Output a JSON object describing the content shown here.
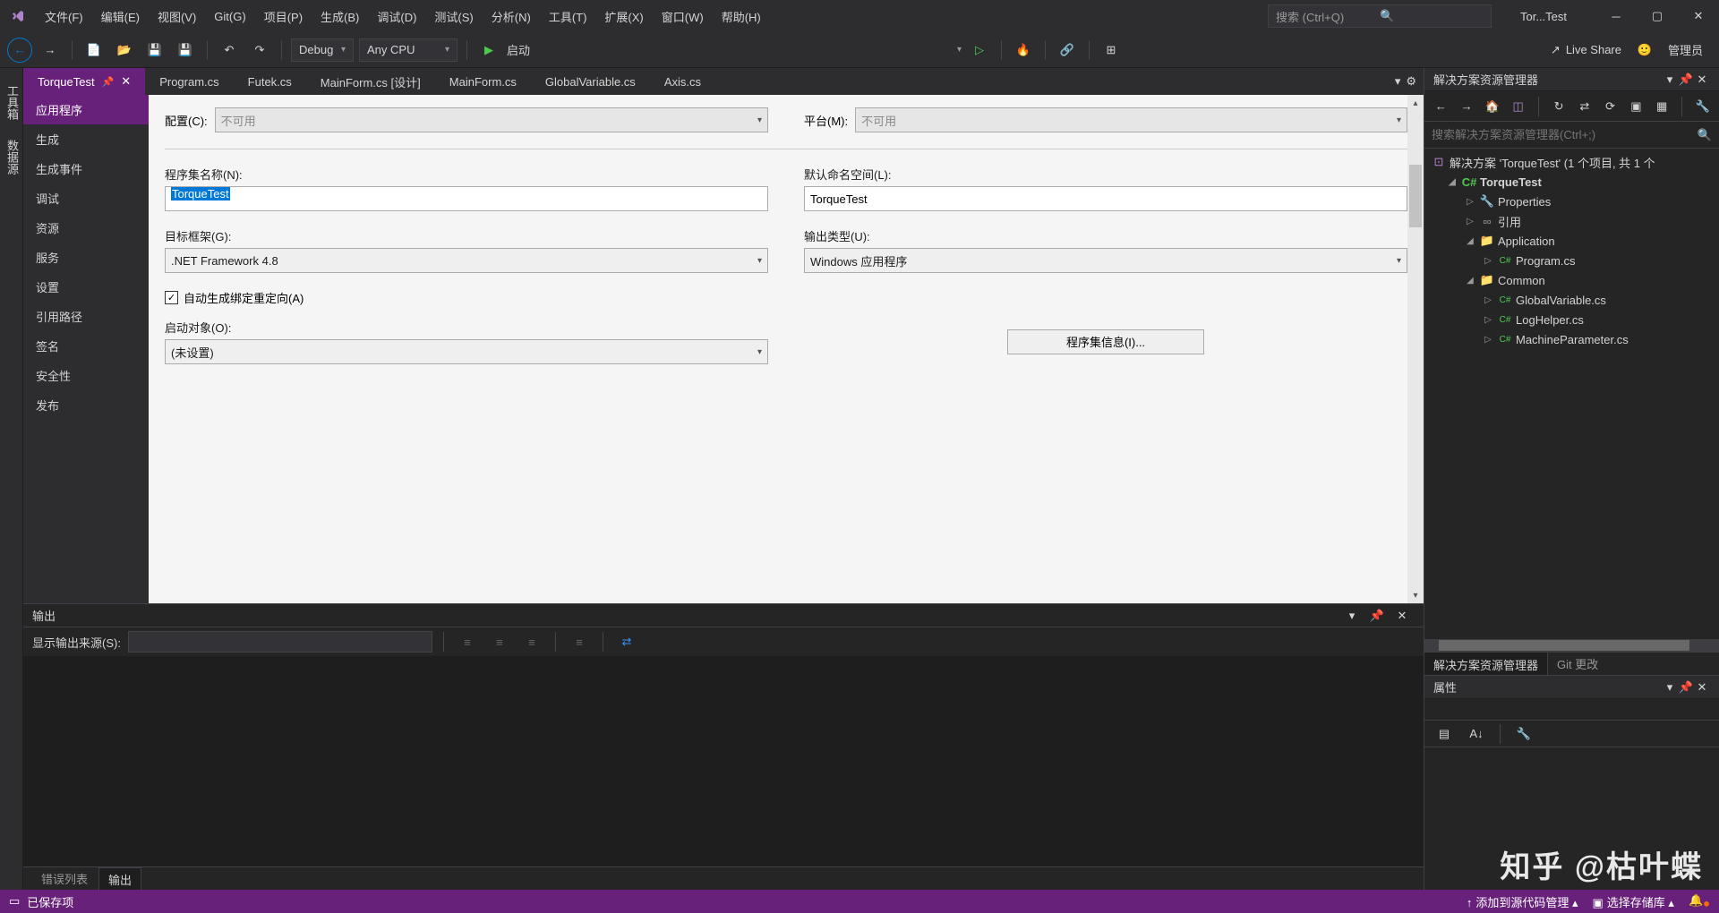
{
  "menubar": [
    "文件(F)",
    "编辑(E)",
    "视图(V)",
    "Git(G)",
    "项目(P)",
    "生成(B)",
    "调试(D)",
    "测试(S)",
    "分析(N)",
    "工具(T)",
    "扩展(X)",
    "窗口(W)",
    "帮助(H)"
  ],
  "search_placeholder": "搜索 (Ctrl+Q)",
  "title_project": "Tor...Test",
  "toolbar": {
    "config": "Debug",
    "platform": "Any CPU",
    "start": "启动",
    "live_share": "Live Share",
    "admin": "管理员"
  },
  "left_tabs": [
    "工具箱",
    "数据源"
  ],
  "doc_tabs": [
    {
      "label": "TorqueTest",
      "active": true,
      "pin": true
    },
    {
      "label": "Program.cs"
    },
    {
      "label": "Futek.cs"
    },
    {
      "label": "MainForm.cs [设计]"
    },
    {
      "label": "MainForm.cs"
    },
    {
      "label": "GlobalVariable.cs"
    },
    {
      "label": "Axis.cs"
    }
  ],
  "props_nav": [
    "应用程序",
    "生成",
    "生成事件",
    "调试",
    "资源",
    "服务",
    "设置",
    "引用路径",
    "签名",
    "安全性",
    "发布"
  ],
  "props": {
    "config_label": "配置(C):",
    "config_value": "不可用",
    "platform_label": "平台(M):",
    "platform_value": "不可用",
    "asm_name_label": "程序集名称(N):",
    "asm_name_value": "TorqueTest",
    "ns_label": "默认命名空间(L):",
    "ns_value": "TorqueTest",
    "framework_label": "目标框架(G):",
    "framework_value": ".NET Framework 4.8",
    "output_label": "输出类型(U):",
    "output_value": "Windows 应用程序",
    "auto_bind_label": "自动生成绑定重定向(A)",
    "startup_label": "启动对象(O):",
    "startup_value": "(未设置)",
    "asm_info_btn": "程序集信息(I)..."
  },
  "output": {
    "title": "输出",
    "source_label": "显示输出来源(S):",
    "tabs": [
      "错误列表",
      "输出"
    ]
  },
  "solution": {
    "title": "解决方案资源管理器",
    "search_placeholder": "搜索解决方案资源管理器(Ctrl+;)",
    "root": "解决方案 'TorqueTest' (1 个项目, 共 1 个",
    "project": "TorqueTest",
    "nodes": {
      "properties": "Properties",
      "references": "引用",
      "application": "Application",
      "program": "Program.cs",
      "common": "Common",
      "global": "GlobalVariable.cs",
      "log": "LogHelper.cs",
      "machine": "MachineParameter.cs"
    },
    "tabs": [
      "解决方案资源管理器",
      "Git 更改"
    ]
  },
  "properties_panel": {
    "title": "属性"
  },
  "status": {
    "saved": "已保存项",
    "source_control": "添加到源代码管理",
    "repo": "选择存储库"
  },
  "watermark": "知乎 @枯叶蝶",
  "colors": {
    "accent": "#68217a",
    "bg": "#2d2d30"
  }
}
